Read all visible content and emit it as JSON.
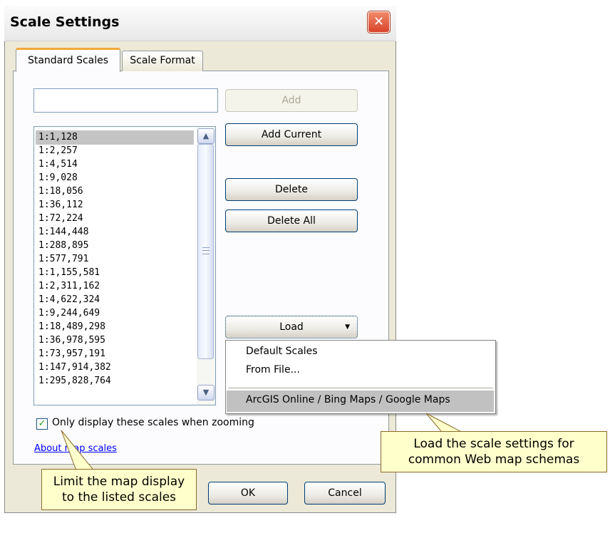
{
  "dialog": {
    "title": "Scale Settings",
    "close_label": "✕"
  },
  "tabs": [
    {
      "label": "Standard Scales",
      "active": true
    },
    {
      "label": "Scale Format",
      "active": false
    }
  ],
  "scale_input": {
    "value": "",
    "placeholder": ""
  },
  "buttons": {
    "add": "Add",
    "add_current": "Add Current",
    "delete": "Delete",
    "delete_all": "Delete All",
    "load": "Load",
    "ok": "OK",
    "cancel": "Cancel"
  },
  "scales": [
    "1:1,128",
    "1:2,257",
    "1:4,514",
    "1:9,028",
    "1:18,056",
    "1:36,112",
    "1:72,224",
    "1:144,448",
    "1:288,895",
    "1:577,791",
    "1:1,155,581",
    "1:2,311,162",
    "1:4,622,324",
    "1:9,244,649",
    "1:18,489,298",
    "1:36,978,595",
    "1:73,957,191",
    "1:147,914,382",
    "1:295,828,764"
  ],
  "selected_scale": "1:1,128",
  "only_display_checkbox": {
    "label": "Only display these scales when zooming",
    "checked": true
  },
  "about_link": "About map scales",
  "load_menu": {
    "items": [
      "Default Scales",
      "From File..."
    ],
    "highlighted_item": "ArcGIS Online / Bing Maps / Google Maps"
  },
  "callouts": {
    "load": [
      "Load the scale settings for",
      "common Web map schemas"
    ],
    "limit": [
      "Limit the map display",
      "to the listed scales"
    ]
  },
  "colors": {
    "dialog_bg": "#ece9d8",
    "close_button": "#d9432a",
    "tab_accent": "#f2a83a",
    "callout_bg": "#ffffcc",
    "link": "#0000ff"
  }
}
